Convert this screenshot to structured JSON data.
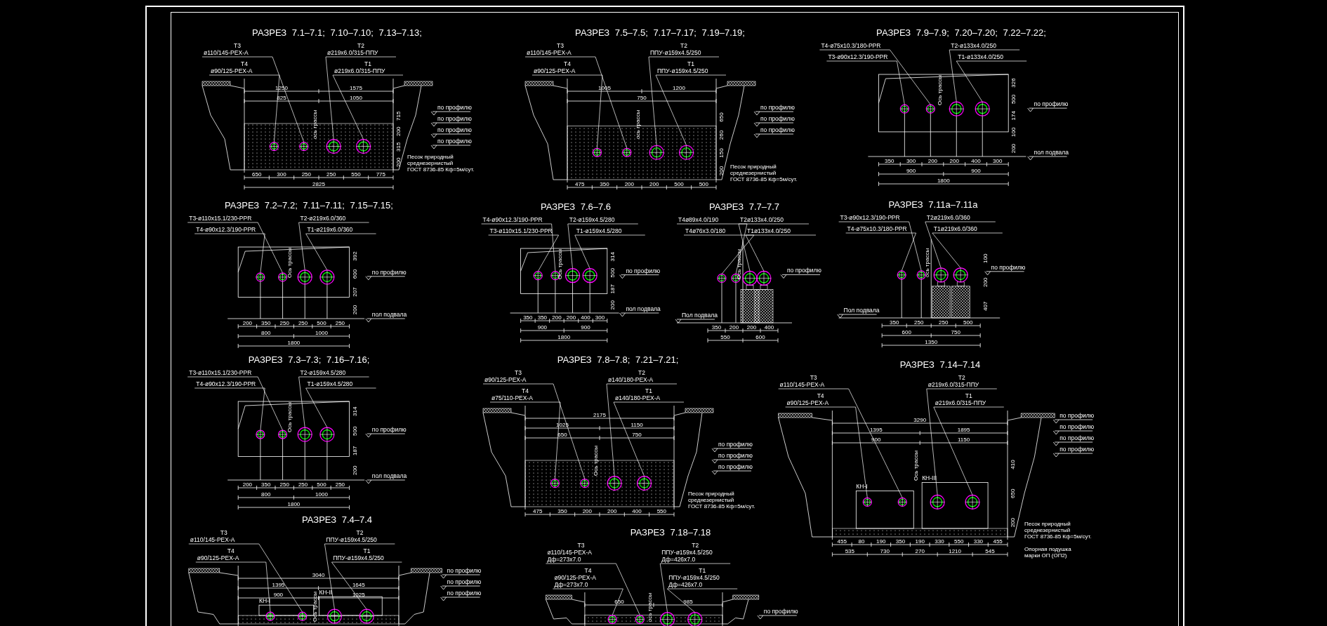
{
  "sheet": {
    "sections": [
      {
        "title": "РАЗРЕЗ 7.1–7.1; 7.10–7.10; 7.13–7.13;",
        "kind": "trench",
        "labels": [
          {
            "lines": [
              "T3",
              "ø110/145-PEX-A"
            ]
          },
          {
            "lines": [
              "T4",
              "ø90/125-PEX-A"
            ]
          },
          {
            "lines": [
              "T2",
              "ø219x6.0/315-ППУ"
            ]
          },
          {
            "lines": [
              "T1",
              "ø219x6.0/315-ППУ"
            ]
          }
        ],
        "top_dims": [
          [
            "1250",
            "1575"
          ],
          [
            "825",
            "1050"
          ]
        ],
        "bottom_dims": [
          [
            "650",
            "300",
            "250",
            "250",
            "550",
            "775"
          ],
          [
            "2825"
          ]
        ],
        "side_dims": [
          "715",
          "200",
          "315",
          "200"
        ],
        "notes": [
          "по профилю",
          "по профилю",
          "по профилю",
          "по профилю"
        ],
        "axis_label": "ось трассы",
        "material_note": [
          "Песок природный",
          "среднезернистый",
          "ГОСТ 8736-85  Кф=5м/сут."
        ]
      },
      {
        "title": "РАЗРЕЗ 7.5–7.5; 7.17–7.17; 7.19–7.19;",
        "kind": "trench",
        "labels": [
          {
            "lines": [
              "T3",
              "ø110/145-PEX-A"
            ]
          },
          {
            "lines": [
              "T4",
              "ø90/125-PEX-A"
            ]
          },
          {
            "lines": [
              "T2",
              "ППУ-ø159x4.5/250"
            ]
          },
          {
            "lines": [
              "T1",
              "ППУ-ø159x4.5/250"
            ]
          }
        ],
        "top_dims": [
          [
            "1005",
            "1200"
          ],
          [
            "750"
          ]
        ],
        "bottom_dims": [
          [
            "475",
            "350",
            "200",
            "200",
            "500",
            "500"
          ]
        ],
        "side_dims": [
          "650",
          "260",
          "150",
          "200"
        ],
        "notes": [
          "по профилю",
          "по профилю",
          "по профилю"
        ],
        "axis_label": "ось трассы",
        "material_note": [
          "Песок природный",
          "среднезернистый",
          "ГОСТ 8736-85  Кф=5м/сут."
        ]
      },
      {
        "title": "РАЗРЕЗ 7.9–7.9; 7.20–7.20; 7.22–7.22;",
        "kind": "slab",
        "labels": [
          {
            "lines": [
              "T4-ø75x10.3/180-PPR"
            ]
          },
          {
            "lines": [
              "T3-ø90x12.3/190-PPR"
            ]
          },
          {
            "lines": [
              "T2-ø133x4.0/250"
            ]
          },
          {
            "lines": [
              "T1-ø133x4.0/250"
            ]
          }
        ],
        "bottom_dims": [
          [
            "350",
            "300",
            "200",
            "200",
            "400",
            "300"
          ],
          [
            "900",
            "900"
          ],
          [
            "1800"
          ]
        ],
        "side_dims": [
          "326",
          "500",
          "174",
          "100",
          "200"
        ],
        "notes": [
          "по профилю",
          "пол подвала"
        ],
        "axis_label": "Ось трассы"
      },
      {
        "title": "РАЗРЕЗ 7.2–7.2; 7.11–7.11; 7.15–7.15;",
        "kind": "slab",
        "labels": [
          {
            "lines": [
              "T3-ø110x15.1/230-PPR"
            ]
          },
          {
            "lines": [
              "T4-ø90x12.3/190-PPR"
            ]
          },
          {
            "lines": [
              "T2-ø219x6.0/360"
            ]
          },
          {
            "lines": [
              "T1-ø219x6.0/360"
            ]
          }
        ],
        "bottom_dims": [
          [
            "200",
            "350",
            "250",
            "250",
            "500",
            "250"
          ],
          [
            "800",
            "1000"
          ],
          [
            "1800"
          ]
        ],
        "side_dims": [
          "392",
          "600",
          "207",
          "200"
        ],
        "notes": [
          "по профилю",
          "пол подвала"
        ],
        "axis_label": "Ось трассы"
      },
      {
        "title": "РАЗРЕЗ 7.6–7.6",
        "kind": "slab",
        "labels": [
          {
            "lines": [
              "T4-ø90x12.3/190-PPR"
            ]
          },
          {
            "lines": [
              "T3-ø110x15.1/230-PPR"
            ]
          },
          {
            "lines": [
              "T2-ø159x4.5/280"
            ]
          },
          {
            "lines": [
              "T1-ø159x4.5/280"
            ]
          }
        ],
        "bottom_dims": [
          [
            "350",
            "350",
            "200",
            "200",
            "400",
            "300"
          ],
          [
            "900",
            "900"
          ],
          [
            "1800"
          ]
        ],
        "side_dims": [
          "314",
          "500",
          "187",
          "200"
        ],
        "notes": [
          "по профилю",
          "пол подвала"
        ],
        "axis_label": "Ось трассы"
      },
      {
        "title": "РАЗРЕЗ 7.7–7.7",
        "kind": "supports",
        "labels": [
          {
            "lines": [
              "T4ø89x4.0/190"
            ]
          },
          {
            "lines": [
              "T4ø76x3.0/180"
            ]
          },
          {
            "lines": [
              "T2ø133x4.0/250"
            ]
          },
          {
            "lines": [
              "T1ø133x4.0/250"
            ]
          }
        ],
        "bottom_dims": [
          [
            "350",
            "200",
            "200",
            "400"
          ],
          [
            "550",
            "600"
          ]
        ],
        "notes": [
          "Пол подвала",
          "по профилю"
        ],
        "axis_label": "Ось трассы"
      },
      {
        "title": "РАЗРЕЗ 7.11а–7.11а",
        "kind": "supports",
        "labels": [
          {
            "lines": [
              "T3-ø90x12.3/190-PPR"
            ]
          },
          {
            "lines": [
              "T4-ø75x10.3/180-PPR"
            ]
          },
          {
            "lines": [
              "T2ø219x6.0/360"
            ]
          },
          {
            "lines": [
              "T1ø219x6.0/360"
            ]
          }
        ],
        "bottom_dims": [
          [
            "350",
            "250",
            "250",
            "500"
          ],
          [
            "600",
            "750"
          ],
          [
            "1350"
          ]
        ],
        "side_dims": [
          "100",
          "200",
          "407"
        ],
        "notes": [
          "Пол подвала",
          "по профилю"
        ],
        "axis_label": "ось трассы"
      },
      {
        "title": "РАЗРЕЗ 7.3–7.3; 7.16–7.16;",
        "kind": "slab",
        "labels": [
          {
            "lines": [
              "T3-ø110x15.1/230-PPR"
            ]
          },
          {
            "lines": [
              "T4-ø90x12.3/190-PPR"
            ]
          },
          {
            "lines": [
              "T2-ø159x4.5/280"
            ]
          },
          {
            "lines": [
              "T1-ø159x4.5/280"
            ]
          }
        ],
        "bottom_dims": [
          [
            "200",
            "350",
            "250",
            "250",
            "500",
            "250"
          ],
          [
            "800",
            "1000"
          ],
          [
            "1800"
          ]
        ],
        "side_dims": [
          "314",
          "500",
          "187",
          "200"
        ],
        "notes": [
          "по профилю",
          "пол подвала"
        ],
        "axis_label": "Ось трассы"
      },
      {
        "title": "РАЗРЕЗ 7.8–7.8; 7.21–7.21;",
        "kind": "trench",
        "labels": [
          {
            "lines": [
              "T3",
              "ø90/125-PEX-A"
            ]
          },
          {
            "lines": [
              "T4",
              "ø75/110-PEX-A"
            ]
          },
          {
            "lines": [
              "T2",
              "ø140/180-PEX-A"
            ]
          },
          {
            "lines": [
              "T1",
              "ø140/180-PEX-A"
            ]
          }
        ],
        "top_dims": [
          [
            "2175"
          ],
          [
            "1025",
            "1150"
          ],
          [
            "650",
            "750"
          ]
        ],
        "bottom_dims": [
          [
            "475",
            "350",
            "200",
            "200",
            "400",
            "550"
          ]
        ],
        "notes": [
          "по профилю",
          "по профилю",
          "по профилю"
        ],
        "axis_label": "Ось трассы",
        "material_note": [
          "Песок природный",
          "среднезернистый",
          "ГОСТ 8736-85  Кф=5м/сут."
        ]
      },
      {
        "title": "РАЗРЕЗ 7.14–7.14",
        "kind": "channel",
        "labels": [
          {
            "lines": [
              "T3",
              "ø110/145-PEX-A"
            ]
          },
          {
            "lines": [
              "T4",
              "ø90/125-PEX-A"
            ]
          },
          {
            "lines": [
              "T2",
              "ø219x6.0/315-ППУ"
            ]
          },
          {
            "lines": [
              "T1",
              "ø219x6.0/315-ППУ"
            ]
          }
        ],
        "top_dims": [
          [
            "3290"
          ],
          [
            "1395",
            "1895"
          ],
          [
            "900",
            "1150"
          ]
        ],
        "bottom_dims": [
          [
            "455",
            "80",
            "190",
            "350",
            "190",
            "330",
            "550",
            "330",
            "455"
          ],
          [
            "535",
            "730",
            "270",
            "1210",
            "545"
          ]
        ],
        "side_dims": [
          "410",
          "650",
          "200"
        ],
        "notes": [
          "по профилю",
          "по профилю",
          "по профилю",
          "по профилю"
        ],
        "axis_label": "Ось трассы",
        "channels": [
          "КН-I",
          "КН-III"
        ],
        "material_note": [
          "Песок природный",
          "среднезернистый",
          "ГОСТ 8736-85  Кф=5м/сут."
        ],
        "support_note": [
          "Опорная подушка",
          "марки ОП (ОП2)"
        ]
      },
      {
        "title": "РАЗРЕЗ 7.4–7.4",
        "kind": "channel",
        "labels": [
          {
            "lines": [
              "T3",
              "ø110/145-PEX-A"
            ]
          },
          {
            "lines": [
              "T4",
              "ø90/125-PEX-A"
            ]
          },
          {
            "lines": [
              "T2",
              "ППУ-ø159x4.5/250"
            ]
          },
          {
            "lines": [
              "T1",
              "ППУ-ø159x4.5/250"
            ]
          }
        ],
        "top_dims": [
          [
            "3040"
          ],
          [
            "1395",
            "1645"
          ],
          [
            "900",
            "1025"
          ]
        ],
        "notes": [
          "по профилю",
          "по профилю",
          "по профилю"
        ],
        "axis_label": "Ось трассы",
        "channels": [
          "КН-I",
          "КН-II"
        ]
      },
      {
        "title": "РАЗРЕЗ 7.18–7.18",
        "kind": "trench",
        "labels": [
          {
            "lines": [
              "T3",
              "ø110/145-PEX-A",
              "Дф=273x7.0"
            ]
          },
          {
            "lines": [
              "T4",
              "ø90/125-PEX-A",
              "Дф=273x7.0"
            ]
          },
          {
            "lines": [
              "T2",
              "ППУ-ø159x4.5/250",
              "Дф=426x7.0"
            ]
          },
          {
            "lines": [
              "T1",
              "ППУ-ø159x4.5/250",
              "Дф=426x7.0"
            ]
          }
        ],
        "top_dims": [
          [
            "650",
            "985"
          ]
        ],
        "notes": [
          "по профилю"
        ],
        "axis_label": "ось трассы"
      }
    ]
  }
}
